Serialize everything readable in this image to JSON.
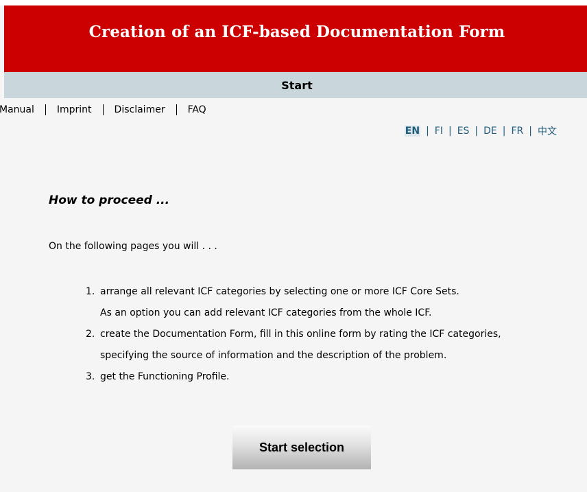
{
  "header": {
    "title": "Creation of an ICF-based Documentation Form"
  },
  "step_bar": {
    "title": "Start"
  },
  "nav": {
    "items": [
      {
        "label": "Manual"
      },
      {
        "label": "Imprint"
      },
      {
        "label": "Disclaimer"
      },
      {
        "label": "FAQ"
      }
    ]
  },
  "languages": {
    "active": "EN",
    "items": [
      {
        "label": "EN"
      },
      {
        "label": "FI"
      },
      {
        "label": "ES"
      },
      {
        "label": "DE"
      },
      {
        "label": "FR"
      },
      {
        "label": "中文"
      }
    ],
    "separator": "|"
  },
  "content": {
    "heading": "How to proceed ...",
    "intro": "On the following pages you will . . .",
    "steps": [
      {
        "number": "1.",
        "line1": "arrange all relevant ICF categories by selecting one or more ICF Core Sets.",
        "line2": "As an option you can add relevant ICF categories from the whole ICF."
      },
      {
        "number": "2.",
        "line1": "create the Documentation Form, fill in this online form by rating the ICF categories,",
        "line2": "specifying the source of information and the description of the problem."
      },
      {
        "number": "3.",
        "line1": "get the Functioning Profile."
      }
    ]
  },
  "actions": {
    "start_label": "Start selection"
  },
  "colors": {
    "header_red": "#cc0000",
    "step_bar_blue_gray": "#c9d7dc",
    "language_link": "#1e5a7a"
  }
}
